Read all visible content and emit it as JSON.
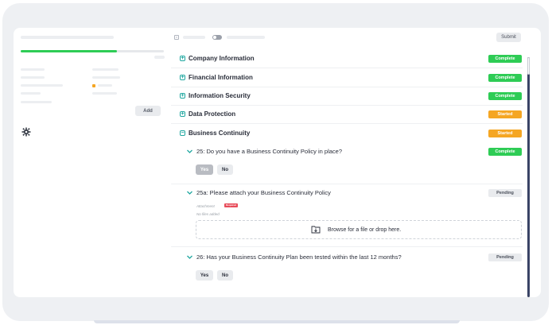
{
  "left_panel": {
    "progress_fraction": 0.67,
    "add_label": "Add"
  },
  "toolbar": {
    "submit_label": "Submit"
  },
  "sections": [
    {
      "title": "Company Information",
      "status": "Complete",
      "expanded": false
    },
    {
      "title": "Financial Information",
      "status": "Complete",
      "expanded": false
    },
    {
      "title": "Information Security",
      "status": "Complete",
      "expanded": false
    },
    {
      "title": "Data Protection",
      "status": "Started",
      "expanded": false
    },
    {
      "title": "Business Continuity",
      "status": "Started",
      "expanded": true
    }
  ],
  "questions": [
    {
      "text": "25: Do you have a Business Continuity Policy in place?",
      "status": "Complete",
      "answer_options": [
        "Yes",
        "No"
      ],
      "selected": "Yes"
    },
    {
      "text": "25a: Please attach your Business Continuity Policy",
      "status": "Pending",
      "attachment_label": "Attachment",
      "required_tag": "Required",
      "no_files": "No files added",
      "dropzone_text": "Browse for a file or drop here."
    },
    {
      "text": "26: Has your Business Continuity Plan been tested within the last 12 months?",
      "status": "Pending",
      "answer_options": [
        "Yes",
        "No"
      ],
      "selected": ""
    }
  ],
  "colors": {
    "complete": "#2ecc55",
    "started": "#f5a623",
    "accent": "#1fa7a0",
    "scrollbar": "#3a4466"
  },
  "icons": {
    "section_collapsed": "plus-square-icon",
    "section_expanded": "minus-square-icon",
    "question": "chevron-down-icon",
    "upload": "upload-folder-icon",
    "settings": "gear-icon"
  }
}
